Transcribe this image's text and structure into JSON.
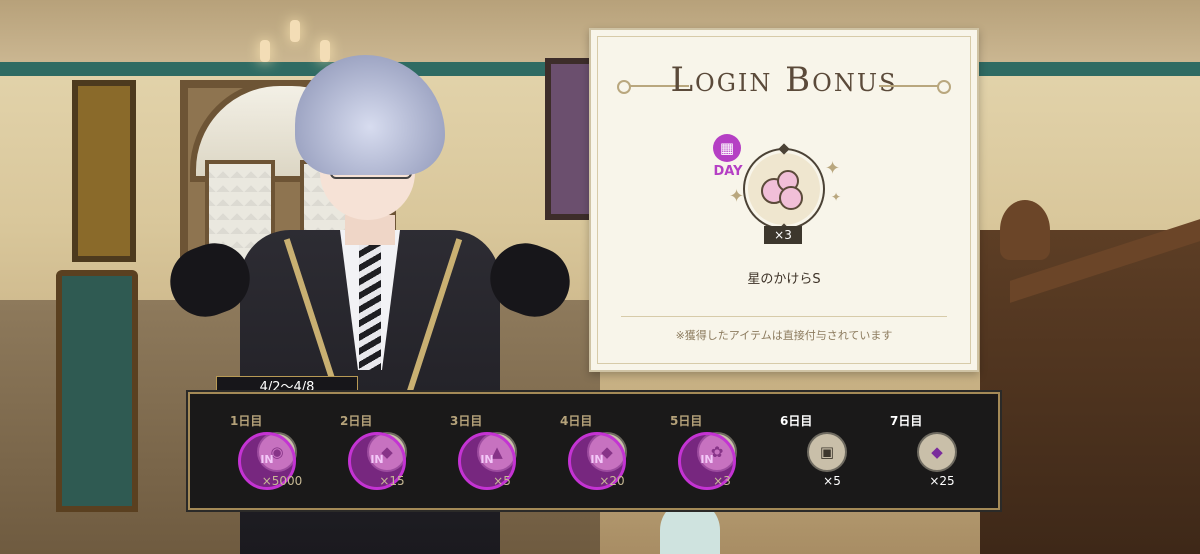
{
  "login_bonus": {
    "title": "Login Bonus",
    "day_label": "DAY",
    "reward_quantity": "×3",
    "reward_name": "星のかけらS",
    "note": "※獲得したアイテムは直接付与されています"
  },
  "calendar": {
    "period": "4/2〜4/8",
    "days": [
      {
        "label": "1日目",
        "quantity": "×5000",
        "icon": "coin-pouch-icon",
        "claimed": true
      },
      {
        "label": "2日目",
        "quantity": "×15",
        "icon": "purple-gem-icon",
        "claimed": true
      },
      {
        "label": "3日目",
        "quantity": "×5",
        "icon": "cupcake-icon",
        "claimed": true
      },
      {
        "label": "4日目",
        "quantity": "×20",
        "icon": "purple-gem-icon",
        "claimed": true
      },
      {
        "label": "5日目",
        "quantity": "×3",
        "icon": "star-fragment-icon",
        "claimed": true
      },
      {
        "label": "6日目",
        "quantity": "×5",
        "icon": "sugar-cubes-icon",
        "claimed": false
      },
      {
        "label": "7日目",
        "quantity": "×25",
        "icon": "purple-gem-icon",
        "claimed": false
      }
    ]
  },
  "colors": {
    "accent": "#b53fc4",
    "stamp": "#c433d3",
    "card_bg": "#f8f5ea",
    "bar_bg": "#1a1919",
    "bar_border": "#a48a57"
  }
}
